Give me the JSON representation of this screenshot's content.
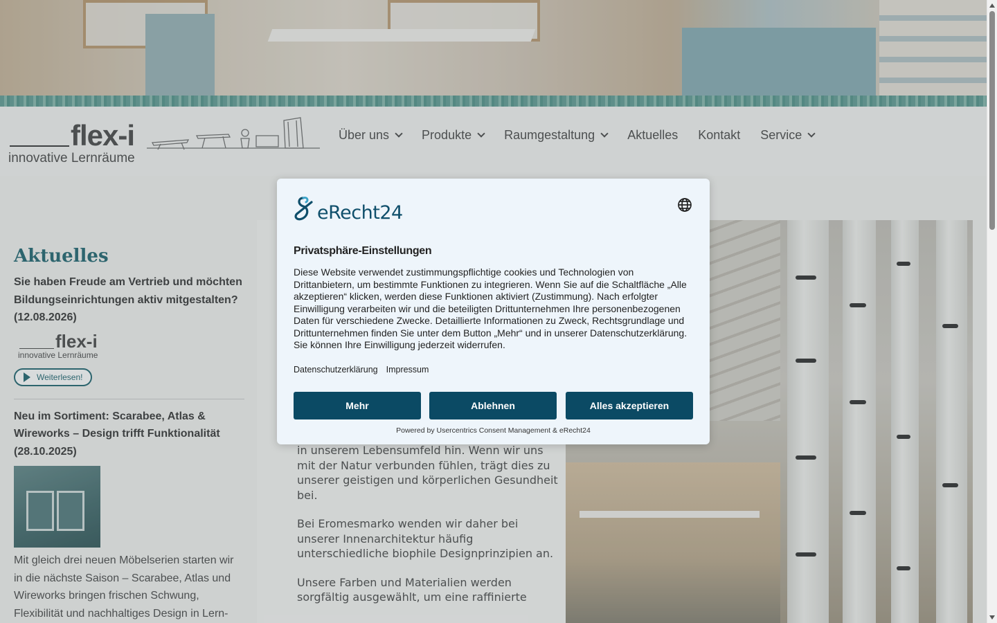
{
  "logo": {
    "brand": "flex-i",
    "tagline": "innovative Lernräume"
  },
  "nav": {
    "items": [
      {
        "label": "Über uns",
        "has_dropdown": true
      },
      {
        "label": "Produkte",
        "has_dropdown": true
      },
      {
        "label": "Raumgestaltung",
        "has_dropdown": true
      },
      {
        "label": "Aktuelles",
        "has_dropdown": false
      },
      {
        "label": "Kontakt",
        "has_dropdown": false
      },
      {
        "label": "Service",
        "has_dropdown": true
      }
    ]
  },
  "sidebar": {
    "heading": "Aktuelles",
    "posts": [
      {
        "title": "Sie haben Freude am Vertrieb und möchten Bildungseinrichtungen aktiv mitgestalten? (12.08.2026)",
        "logo_brand": "flex-i",
        "logo_tagline": "innovative Lernräume",
        "read_more": "Weiterlesen!"
      },
      {
        "title": "Neu im Sortiment: Scarabee, Atlas & Wireworks – Design trifft Funktionalität (28.10.2025)",
        "text": "Mit gleich drei neuen Möbelserien starten wir in die nächste Saison – Scarabee, Atlas und Wireworks bringen frischen Schwung, Flexibilität und nachhaltiges Design in Lern-"
      }
    ]
  },
  "main": {
    "paragraphs": [
      "in unserem Lebensumfeld hin. Wenn wir uns mit der Natur verbunden fühlen, trägt dies zu unserer geistigen und körperlichen Gesundheit bei.",
      "Bei Eromesmarko wenden wir daher bei unserer Innenarchitektur häufig unterschiedliche biophile Designprinzipien an.",
      "Unsere Farben und Materialien werden sorgfältig ausgewählt, um eine raffinierte"
    ]
  },
  "consent": {
    "logo_text": "eRecht24",
    "title": "Privatsphäre-Einstellungen",
    "body": "Diese Website verwendet zustimmungspflichtige cookies und Technologien von Drittanbietern, um bestimmte Funktionen zu integrieren. Wenn Sie auf die Schaltfläche „Alle akzeptieren“ klicken, werden diese Funktionen aktiviert (Zustimmung). Nach erfolgter Einwilligung verarbeiten wir und die beteiligten Drittunternehmen Ihre personenbezogenen Daten für verschiedene Zwecke. Detaillierte Informationen zu Zweck, Rechtsgrundlage und Drittunternehmen finden Sie unter dem Button „Mehr“ und in unserer Datenschutzerklärung. Sie können Ihre Einwilligung jederzeit widerrufen.",
    "link_privacy": "Datenschutzerklärung",
    "link_imprint": "Impressum",
    "btn_more": "Mehr",
    "btn_decline": "Ablehnen",
    "btn_accept": "Alles akzeptieren",
    "powered_by": "Powered by Usercentrics Consent Management & eRecht24",
    "accent_color": "#0b4a64"
  }
}
